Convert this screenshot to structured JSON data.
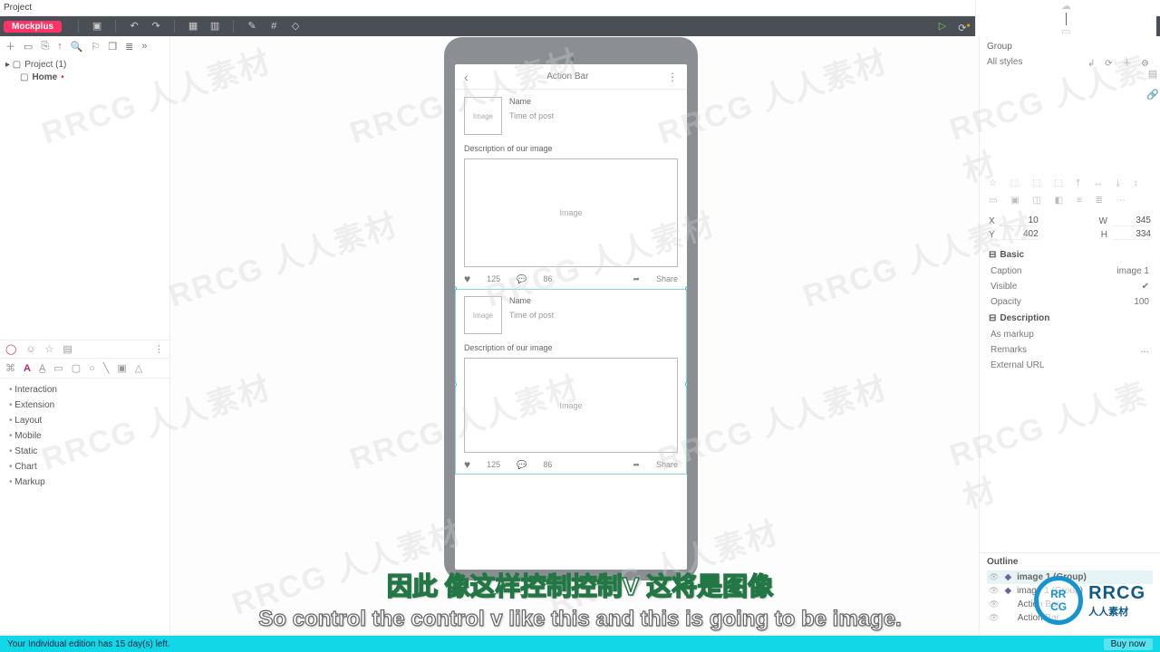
{
  "window": {
    "title": "Project",
    "controls": [
      "—",
      "☐",
      "✕"
    ]
  },
  "brand": "Mockplus",
  "project_tree": {
    "root": "Project (1)",
    "page": "Home",
    "modified": "•"
  },
  "components": [
    "Interaction",
    "Extension",
    "Layout",
    "Mobile",
    "Static",
    "Chart",
    "Markup"
  ],
  "device": {
    "actionbar": {
      "title": "Action Bar"
    },
    "post": {
      "thumb": "Image",
      "name": "Name",
      "time": "Time of post",
      "desc": "Description of our image",
      "image": "Image",
      "likes": "125",
      "comments": "86",
      "share": "Share"
    }
  },
  "props": {
    "group": "Group",
    "allstyles": "All styles",
    "X": "10",
    "Y": "402",
    "W": "345",
    "H": "334",
    "basic": "Basic",
    "caption_l": "Caption",
    "caption_v": "image 1",
    "visible_l": "Visible",
    "opacity_l": "Opacity",
    "opacity_v": "100",
    "description": "Description",
    "asmarkup": "As markup",
    "remarks": "Remarks",
    "exturl": "External URL"
  },
  "outline": {
    "title": "Outline",
    "items": [
      {
        "label": "image 1 (Group)",
        "sel": true
      },
      {
        "label": "image 1 (Group)",
        "sel": false
      },
      {
        "label": "Action Bar",
        "sel": false
      },
      {
        "label": "Action Bar",
        "sel": false
      }
    ]
  },
  "status": {
    "left": "Your Individual edition has 15 day(s) left.",
    "buy": "Buy now"
  },
  "subs": {
    "cn": "因此 像这样控制控制V 这将是图像",
    "en": "So control the control v like this and this is going to be image."
  },
  "wm": "RRCG 人人素材"
}
